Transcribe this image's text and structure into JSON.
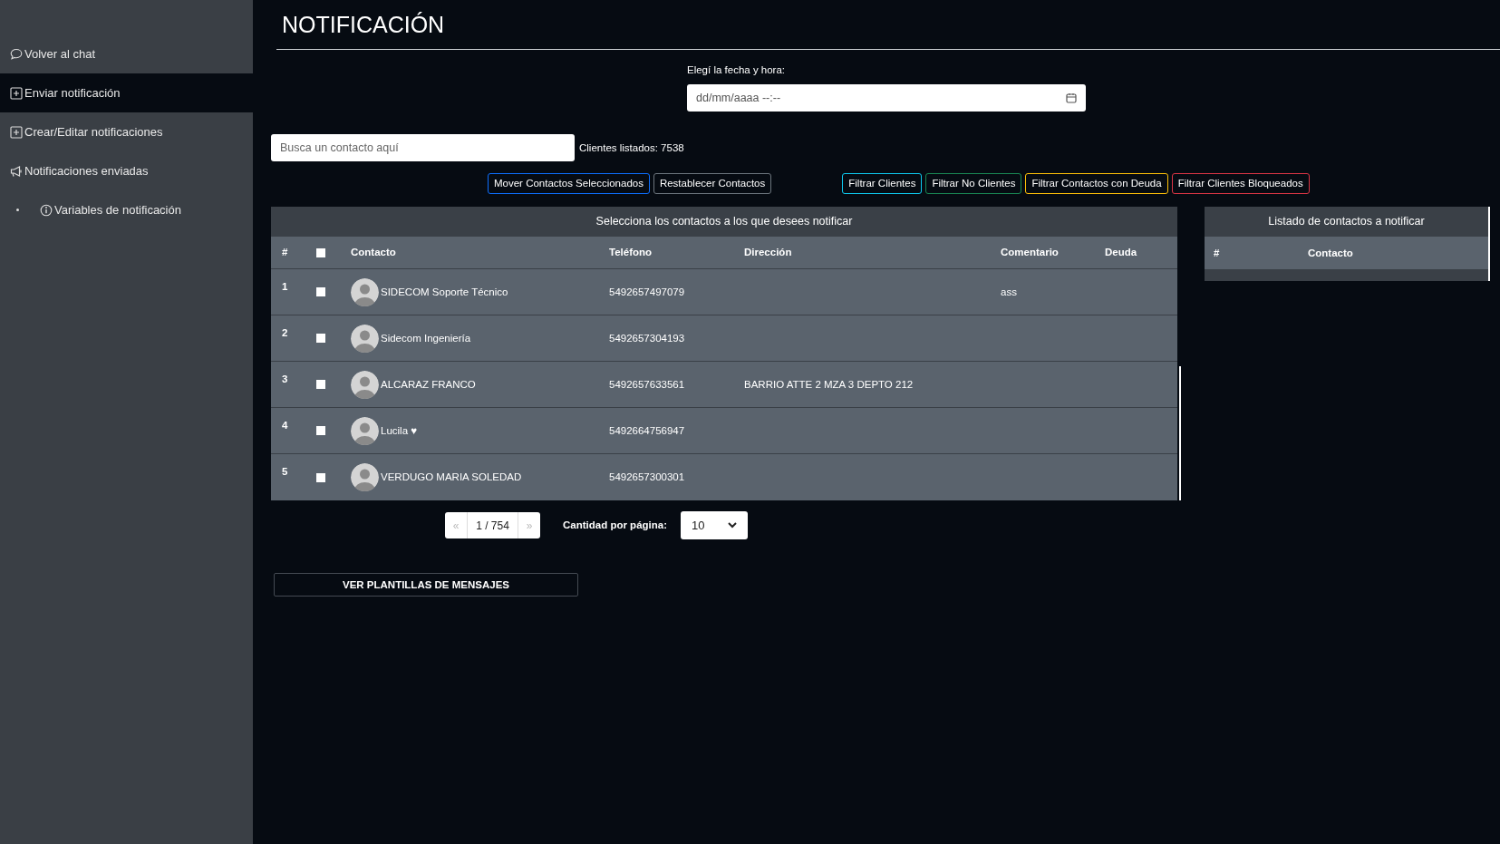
{
  "sidebar": {
    "items": [
      {
        "label": "Volver al chat",
        "selected": false
      },
      {
        "label": "Enviar notificación",
        "selected": true
      },
      {
        "label": "Crear/Editar notificaciones",
        "selected": false
      },
      {
        "label": "Notificaciones enviadas",
        "selected": false,
        "children": [
          {
            "label": "Variables de notificación",
            "selected": false
          }
        ]
      }
    ]
  },
  "title": "NOTIFICACIÓN",
  "datetime": {
    "label": "Elegí la fecha y hora:",
    "placeholder": "dd/mm/aaaa --:--"
  },
  "search": {
    "placeholder": "Busca un contacto aquí",
    "count": "Clientes listados: 7538"
  },
  "buttons": [
    {
      "label": "Mover Contactos Seleccionados",
      "color": "#0d6efd"
    },
    {
      "label": "Restablecer Contactos",
      "color": "#6c757d"
    }
  ],
  "filters": [
    {
      "label": "Filtrar Clientes",
      "color": "#0dcaf0"
    },
    {
      "label": "Filtrar No Clientes",
      "color": "#198754"
    },
    {
      "label": "Filtrar Contactos con Deuda",
      "color": "#ffc107"
    },
    {
      "label": "Filtrar Clientes Bloqueados",
      "color": "#dc3545"
    }
  ],
  "table": {
    "title": "Selecciona los contactos a los que desees notificar",
    "columns": [
      "#",
      "Contacto",
      "Teléfono",
      "Dirección",
      "Comentario",
      "Deuda"
    ],
    "all_checked": false,
    "rows": [
      {
        "number": "1",
        "checked": false,
        "contact": "SIDECOM Soporte Técnico",
        "phone": "5492657497079",
        "address": "",
        "comment": "ass"
      },
      {
        "number": "2",
        "checked": false,
        "contact": "Sidecom Ingeniería",
        "phone": "5492657304193",
        "address": "",
        "comment": ""
      },
      {
        "number": "3",
        "checked": false,
        "contact": "ALCARAZ FRANCO",
        "phone": "5492657633561",
        "address": "BARRIO ATTE 2 MZA 3 DEPTO 212",
        "comment": ""
      },
      {
        "number": "4",
        "checked": false,
        "contact": "Lucila ♥",
        "phone": "5492664756947",
        "address": "",
        "comment": ""
      },
      {
        "number": "5",
        "checked": false,
        "contact": "VERDUGO MARIA SOLEDAD",
        "phone": "5492657300301",
        "address": "",
        "comment": ""
      }
    ]
  },
  "pagination": {
    "prev": "«",
    "page": "1 / 754",
    "next": "»",
    "prev_disabled": true,
    "next_disabled": true,
    "per_page_label": "Cantidad por página:",
    "per_page": "10"
  },
  "selected_list": {
    "title": "Listado de contactos a notificar",
    "columns": [
      "#",
      "Contacto"
    ]
  },
  "templates_button": "VER PLANTILLAS DE MENSAJES"
}
